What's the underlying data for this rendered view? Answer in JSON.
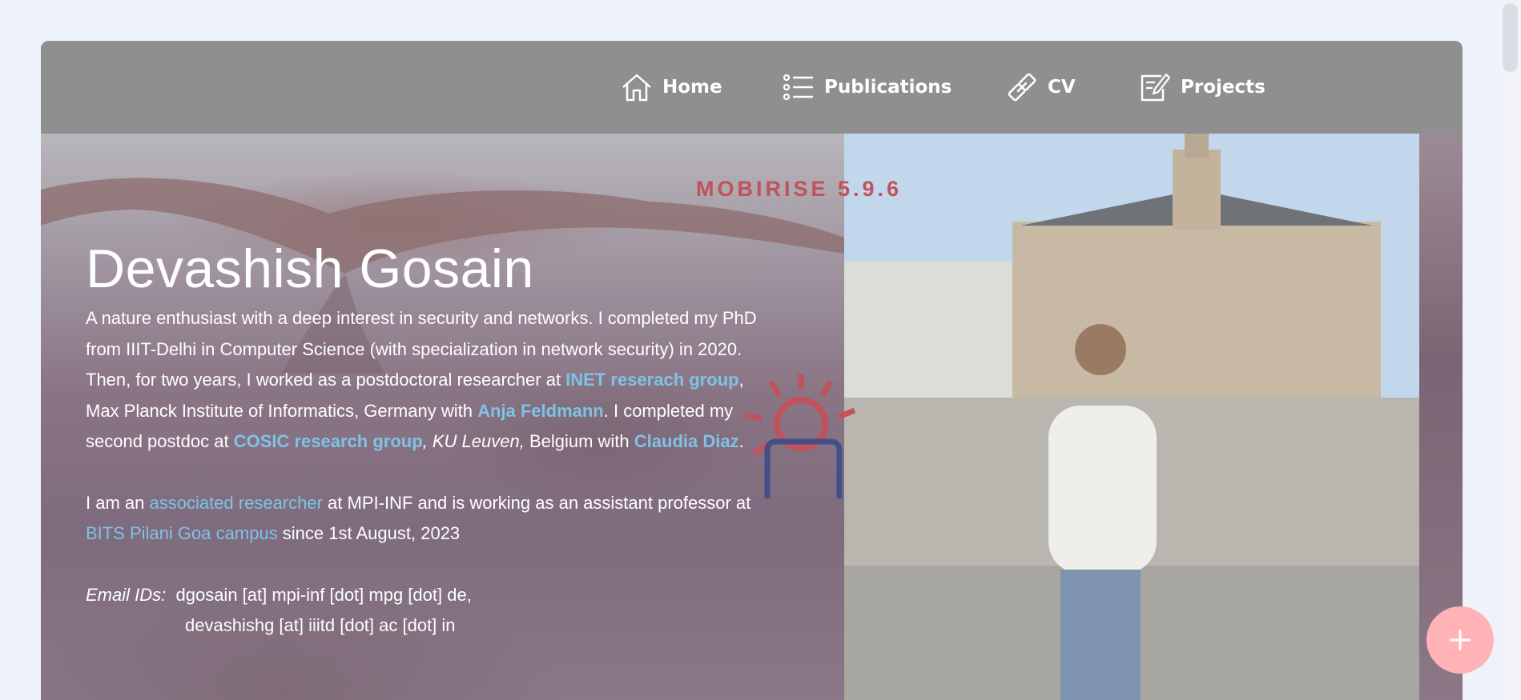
{
  "nav": {
    "items": [
      {
        "label": "Home",
        "icon": "home-icon"
      },
      {
        "label": "Publications",
        "icon": "list-icon"
      },
      {
        "label": "CV",
        "icon": "link-icon"
      },
      {
        "label": "Projects",
        "icon": "edit-icon"
      }
    ]
  },
  "hero": {
    "watermark": "MOBIRISE  5.9.6",
    "name": "Devashish Gosain",
    "bio1": {
      "t1": "A nature enthusiast with a deep interest in security and networks. I completed my PhD from IIIT-Delhi in Computer Science (with specialization in network security) in 2020. Then, for two years, I worked as a postdoctoral researcher at ",
      "link1": "INET reserach group",
      "t2": ", Max Planck Institute of Informatics, Germany with ",
      "link2": "Anja Feldmann",
      "t3": ". I completed my second postdoc  at ",
      "link3": "COSIC research group",
      "t4": ", KU Leuven,",
      "t5": " Belgium  with ",
      "link4": "Claudia Diaz",
      "t6": "."
    },
    "bio2": {
      "t1": "I am an ",
      "link1": "associated researcher",
      "t2": " at MPI-INF and is working as an assistant professor at ",
      "link2": "BITS Pilani Goa campus",
      "t3": " since 1st August, 2023"
    },
    "email": {
      "label": "Email IDs:",
      "line1": "dgosain [at] mpi-inf [dot] mpg [dot] de,",
      "line2": "devashishg [at] iiitd [dot] ac [dot] in"
    }
  },
  "colors": {
    "navbar": "#8f8f8f",
    "link": "#7ec3e6",
    "watermark": "#c0525c",
    "fab": "#ffb3b6"
  },
  "fab": {
    "icon": "plus-icon"
  }
}
